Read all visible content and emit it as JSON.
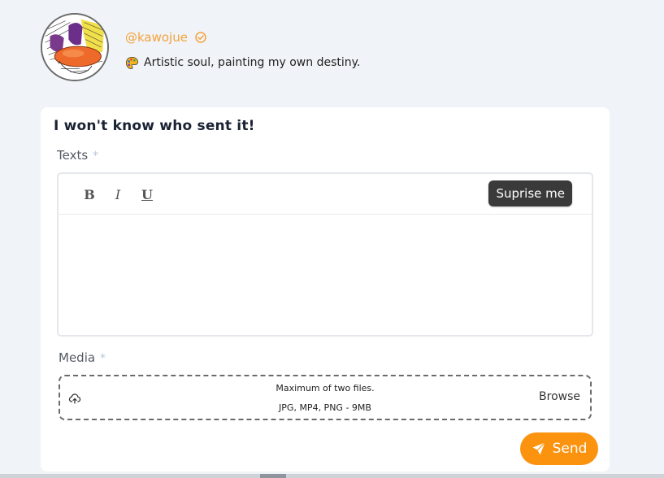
{
  "profile": {
    "username": "@kawojue",
    "bio": "Artistic soul, painting my own destiny.",
    "verified_icon": "verified-check-icon",
    "bio_icon": "palette-emoji"
  },
  "form": {
    "title": "I won't know who sent it!",
    "texts_label": "Texts",
    "required_mark": "*",
    "toolbar": {
      "bold": "B",
      "italic": "I",
      "underline": "U",
      "suprise_label": "Suprise me"
    },
    "media_label": "Media",
    "dropzone": {
      "line1": "Maximum of two files.",
      "line2": "JPG, MP4, PNG - 9MB",
      "browse_label": "Browse",
      "icon": "cloud-upload-icon"
    },
    "send_label": "Send"
  },
  "colors": {
    "accent": "#fb930f",
    "username": "#f4a23c",
    "background": "#f0f3f7",
    "dark_button": "#3a3a3a"
  }
}
